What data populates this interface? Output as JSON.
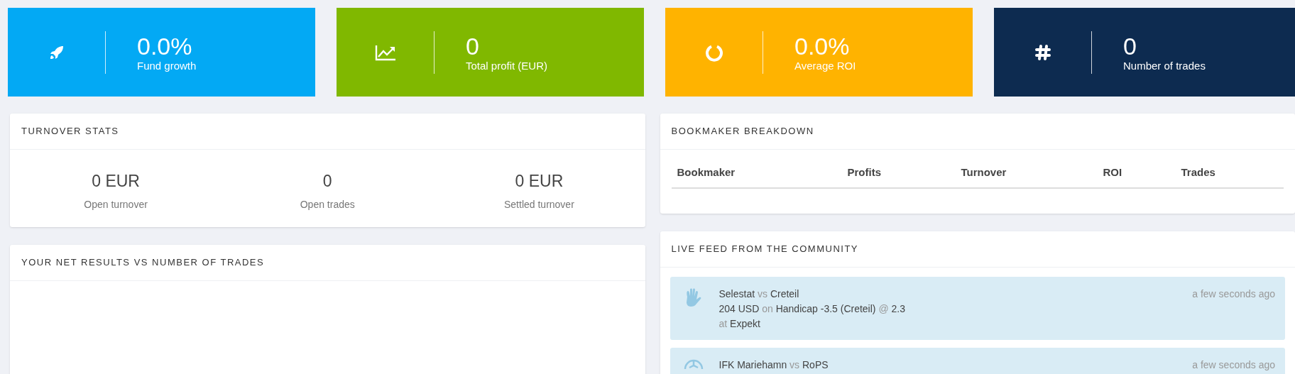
{
  "stat_cards": [
    {
      "kind": "rocket",
      "color": "#03a9f4",
      "value": "0.0%",
      "label": "Fund growth"
    },
    {
      "kind": "chart",
      "color": "#80b800",
      "value": "0",
      "label": "Total profit (EUR)"
    },
    {
      "kind": "ring",
      "color": "#ffb300",
      "value": "0.0%",
      "label": "Average ROI"
    },
    {
      "kind": "hash",
      "color": "#0d2b50",
      "value": "0",
      "label": "Number of trades"
    }
  ],
  "turnover_stats": {
    "title": "TURNOVER STATS",
    "stats": [
      {
        "value": "0 EUR",
        "label": "Open turnover"
      },
      {
        "value": "0",
        "label": "Open trades"
      },
      {
        "value": "0 EUR",
        "label": "Settled turnover"
      }
    ]
  },
  "net_results": {
    "title": "YOUR NET RESULTS VS NUMBER OF TRADES"
  },
  "bookmaker_breakdown": {
    "title": "BOOKMAKER BREAKDOWN",
    "columns": [
      "Bookmaker",
      "Profits",
      "Turnover",
      "ROI",
      "Trades"
    ]
  },
  "live_feed": {
    "title": "LIVE FEED FROM THE COMMUNITY",
    "items": [
      {
        "kind": "hand",
        "time": "a few seconds ago",
        "lines": [
          [
            {
              "t": "Selestat",
              "muted": false
            },
            {
              "t": "vs",
              "muted": true
            },
            {
              "t": "Creteil",
              "muted": false
            }
          ],
          [
            {
              "t": "204 USD",
              "muted": false
            },
            {
              "t": "on",
              "muted": true
            },
            {
              "t": "Handicap -3.5 (Creteil)",
              "muted": false
            },
            {
              "t": "@",
              "muted": true
            },
            {
              "t": "2.3",
              "muted": false
            }
          ],
          [
            {
              "t": "at",
              "muted": true
            },
            {
              "t": "Expekt",
              "muted": false
            }
          ]
        ]
      },
      {
        "kind": "ball",
        "time": "a few seconds ago",
        "lines": [
          [
            {
              "t": "IFK Mariehamn",
              "muted": false
            },
            {
              "t": "vs",
              "muted": true
            },
            {
              "t": "RoPS",
              "muted": false
            }
          ]
        ]
      }
    ]
  }
}
